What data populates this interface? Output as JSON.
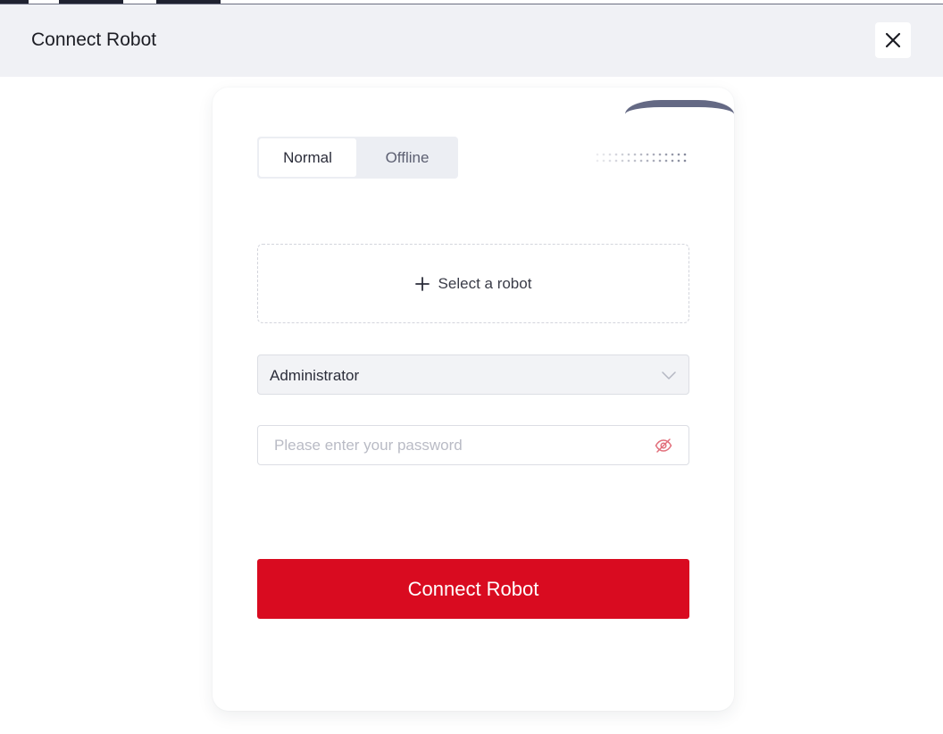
{
  "dialog": {
    "title": "Connect Robot",
    "close_icon": "close-icon"
  },
  "mode_tabs": [
    {
      "label": "Normal",
      "selected": true
    },
    {
      "label": "Offline",
      "selected": false
    }
  ],
  "select_robot": {
    "icon": "plus-icon",
    "label": "Select a robot"
  },
  "role": {
    "value": "Administrator",
    "icon": "chevron-down-icon"
  },
  "password": {
    "value": "",
    "placeholder": "Please enter your password",
    "icon": "eye-slash-icon"
  },
  "connect_button": {
    "label": "Connect Robot"
  },
  "colors": {
    "accent": "#d90b20",
    "header_bg": "#f0f1f5",
    "card_arc": "#646984",
    "eye_icon": "#e2707c"
  }
}
